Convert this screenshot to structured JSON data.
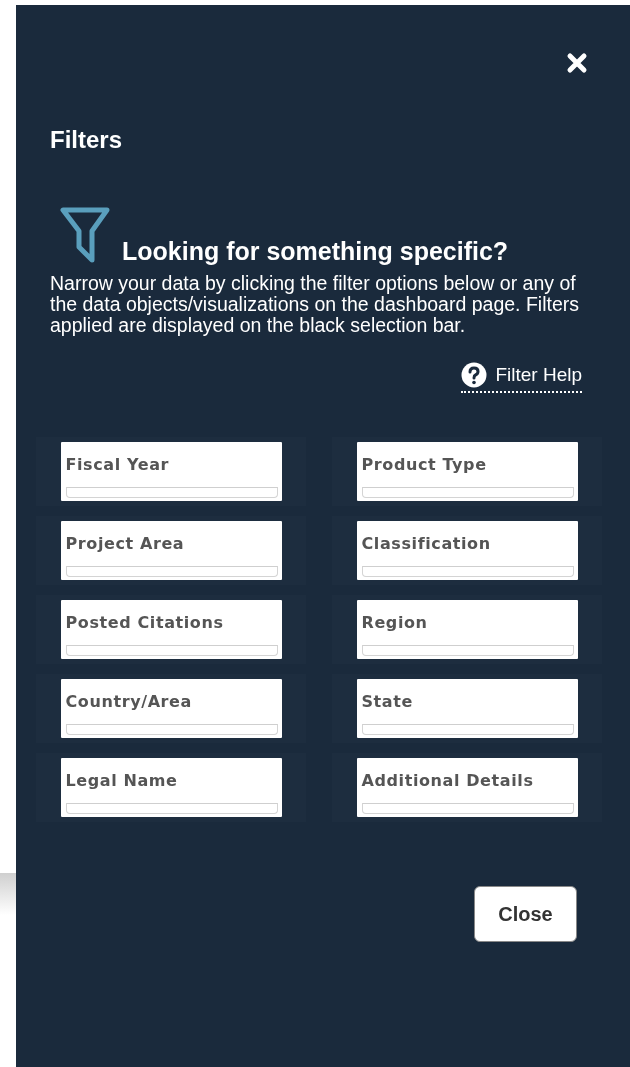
{
  "panel": {
    "title": "Filters",
    "heading": "Looking for something specific?",
    "description": "Narrow your data by clicking the filter options below or any of the data objects/visualizations on the dashboard page. Filters applied are displayed on the black selection bar.",
    "help_link": "Filter Help",
    "filters": [
      {
        "label": "Fiscal Year"
      },
      {
        "label": "Product Type"
      },
      {
        "label": "Project Area"
      },
      {
        "label": "Classification"
      },
      {
        "label": "Posted Citations"
      },
      {
        "label": "Region"
      },
      {
        "label": "Country/Area"
      },
      {
        "label": "State"
      },
      {
        "label": "Legal Name"
      },
      {
        "label": "Additional Details"
      }
    ],
    "close_button": "Close"
  }
}
